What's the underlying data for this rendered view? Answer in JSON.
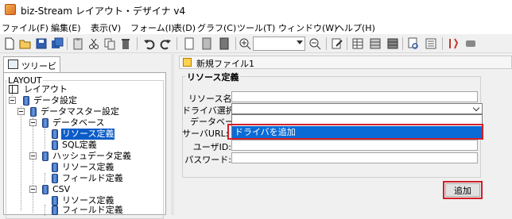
{
  "window": {
    "title": "biz-Stream レイアウト・デザイナ v4"
  },
  "menu": [
    "ファイル(F)",
    "編集(E)",
    "表示(V)",
    "フォーム(I)",
    "表(D)",
    "グラフ(C)",
    "ツール(T)",
    "ウィンドウ(W)",
    "ヘルプ(H)"
  ],
  "toolbar": {
    "icons": [
      "new-icon",
      "open-icon",
      "save-icon",
      "save-all-icon",
      "paste-icon",
      "cut-icon",
      "copy-icon",
      "delete-icon",
      "undo-icon",
      "redo-icon",
      "page-icon",
      "page-gray-icon",
      "page-dark-icon",
      "zoom-in-icon",
      "zoom-out-icon",
      "edit-icon",
      "table-icon",
      "table-gray-icon",
      "preview-icon",
      "list-icon",
      "wrench-icon",
      "stop-icon"
    ],
    "zoom_value": ""
  },
  "tree": {
    "tab_label": "ツリービュー",
    "group_label": "LAYOUT",
    "nodes": [
      {
        "label": "レイアウト",
        "icon": "layout-icon",
        "selected": false
      },
      {
        "label": "データ設定",
        "icon": "database-icon",
        "selected": false
      },
      {
        "label": "データマスター設定",
        "icon": "database-icon",
        "selected": false
      },
      {
        "label": "データベース",
        "icon": "database-icon",
        "selected": false
      },
      {
        "label": "リソース定義",
        "icon": "database-icon",
        "selected": true
      },
      {
        "label": "SQL定義",
        "icon": "database-icon",
        "selected": false
      },
      {
        "label": "ハッシュデータ定義",
        "icon": "database-icon",
        "selected": false
      },
      {
        "label": "リソース定義",
        "icon": "database-icon",
        "selected": false
      },
      {
        "label": "フィールド定義",
        "icon": "database-icon",
        "selected": false
      },
      {
        "label": "CSV",
        "icon": "database-icon",
        "selected": false
      },
      {
        "label": "リソース定義",
        "icon": "database-icon",
        "selected": false
      },
      {
        "label": "フィールド定義",
        "icon": "database-icon",
        "selected": false
      }
    ]
  },
  "document": {
    "tab_title": "新規ファイル1",
    "section_title": "リソース定義",
    "fields": {
      "resource_name_label": "リソース名:",
      "resource_name_value": "",
      "driver_label": "ドライバ選択:",
      "driver_value": "",
      "database_label": "データベー",
      "server_url_label": "サーバURL:",
      "user_id_label": "ユーザID:",
      "user_id_value": "",
      "password_label": "パスワード:",
      "password_value": ""
    },
    "dropdown_option": "ドライバを追加",
    "add_button_label": "追加",
    "highlight_color": "#d0202a",
    "selection_color": "#0b6bd6"
  }
}
